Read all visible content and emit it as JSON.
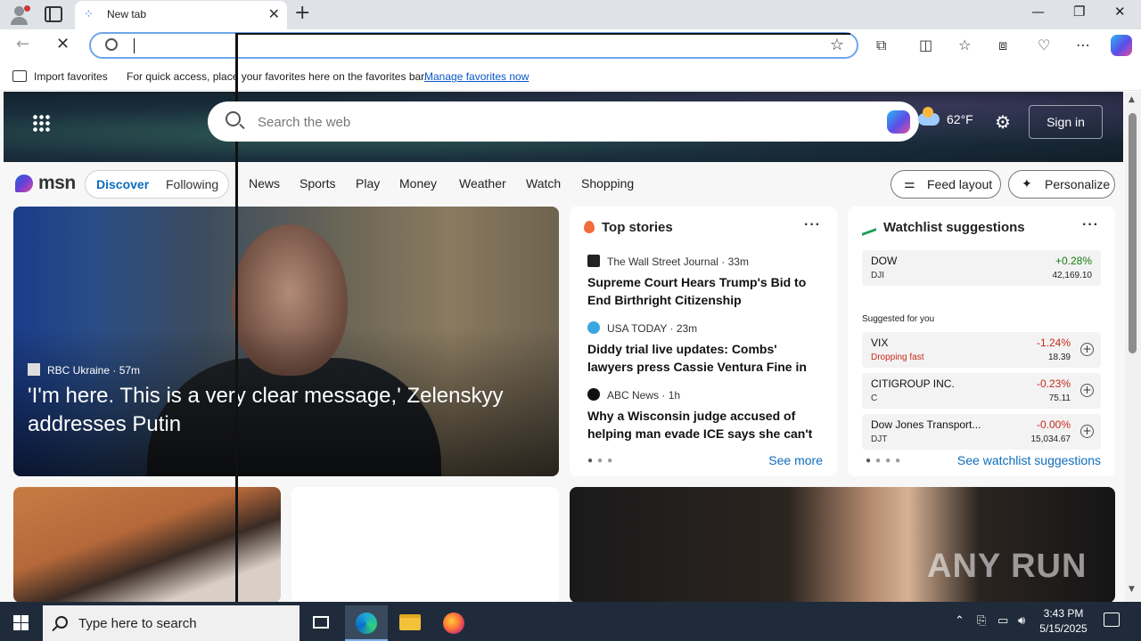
{
  "browser": {
    "tab_title": "New tab",
    "favorites_bar": {
      "import_label": "Import favorites",
      "message": "For quick access, place your favorites here on the favorites bar.",
      "manage_link": "Manage favorites now"
    }
  },
  "msn": {
    "search_placeholder": "Search the web",
    "weather": {
      "temp": "62°F"
    },
    "sign_in": "Sign in",
    "logo_text": "msn",
    "tabs": [
      "Discover",
      "Following"
    ],
    "nav": [
      "News",
      "Sports",
      "Play",
      "Money",
      "Weather",
      "Watch",
      "Shopping"
    ],
    "feed_layout": "Feed layout",
    "personalize": "Personalize",
    "hero": {
      "source": "RBC Ukraine",
      "age": "57m",
      "headline": "'I'm here. This is a very clear message,' Zelenskyy addresses Putin"
    },
    "top_stories": {
      "title": "Top stories",
      "items": [
        {
          "source": "The Wall Street Journal",
          "age": "33m",
          "headline": "Supreme Court Hears Trump's Bid to End Birthright Citizenship"
        },
        {
          "source": "USA TODAY",
          "age": "23m",
          "headline": "Diddy trial live updates: Combs' lawyers press Cassie Ventura Fine in cross-..."
        },
        {
          "source": "ABC News",
          "age": "1h",
          "headline": "Why a Wisconsin judge accused of helping man evade ICE says she can't b..."
        }
      ],
      "see_more": "See more"
    },
    "watchlist": {
      "title": "Watchlist suggestions",
      "main": {
        "name": "DOW",
        "ticker": "DJI",
        "change": "+0.28%",
        "price": "42,169.10"
      },
      "suggested_label": "Suggested for you",
      "suggestions": [
        {
          "name": "VIX",
          "sub": "Dropping fast",
          "change": "-1.24%",
          "price": "18.39"
        },
        {
          "name": "CITIGROUP INC.",
          "sub": "C",
          "change": "-0.23%",
          "price": "75.11"
        },
        {
          "name": "Dow Jones Transport...",
          "sub": "DJT",
          "change": "-0.00%",
          "price": "15,034.67"
        }
      ],
      "see_link": "See watchlist suggestions"
    },
    "watermark": "ANY RUN"
  },
  "taskbar": {
    "search_placeholder": "Type here to search",
    "time": "3:43 PM",
    "date": "5/15/2025"
  },
  "colors": {
    "accent": "#0f6cbd",
    "positive": "#107c10",
    "negative": "#c42b1c"
  }
}
